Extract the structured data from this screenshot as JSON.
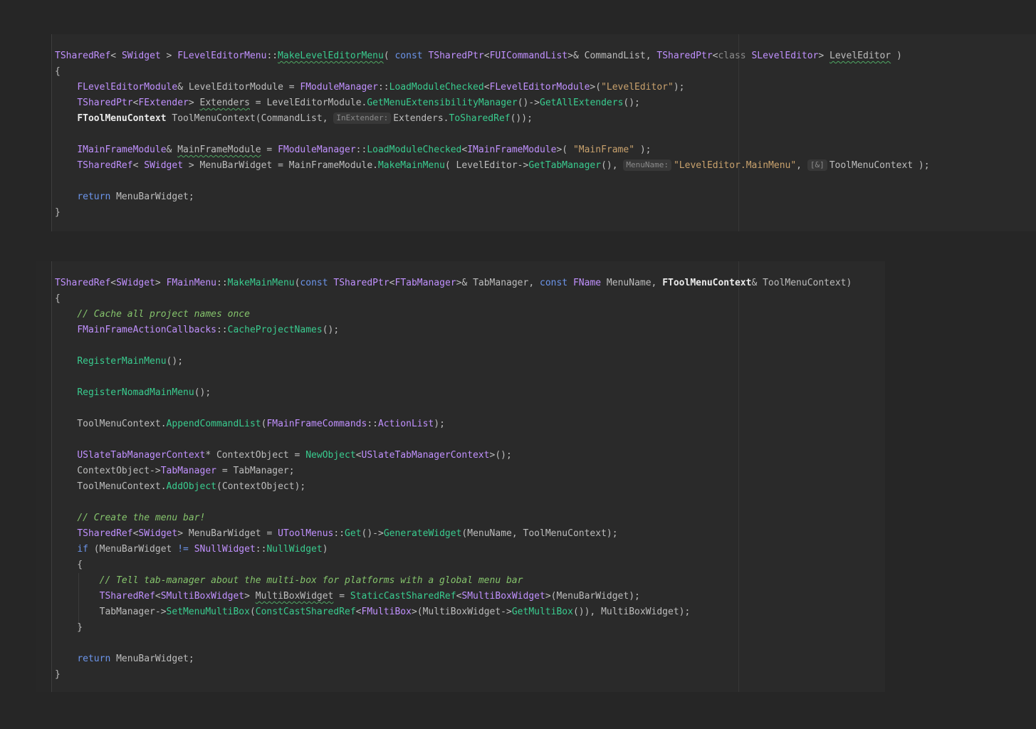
{
  "editor": {
    "description": "Dark IDE code viewer showing two C++ (Unreal Engine) function snippets",
    "colors": {
      "page_background": "#262626",
      "block_background": "#2a2a2a",
      "gutter_background": "#272727",
      "left_separator": "#3e3e3e",
      "right_margin_guide": "#363636",
      "indent_guide": "#3b3b3b",
      "text_default": "#bdbdbd",
      "text_type": "#c191ff",
      "text_method": "#39cc8f",
      "text_keyword": "#6c95eb",
      "text_string": "#c9a26d",
      "text_comment": "#85c46c",
      "text_dim_keyword": "#8c8c8c",
      "text_highlighted_usage": "#ebebeb",
      "inlay_hint_text": "#8a8a8a",
      "inlay_hint_background": "#383838",
      "typo_squiggle": "#4fa863"
    },
    "blocks": [
      {
        "name": "FLevelEditorMenu::MakeLevelEditorMenu",
        "lines": [
          [
            [
              "type",
              "TSharedRef"
            ],
            [
              "plain",
              "< "
            ],
            [
              "type",
              "SWidget"
            ],
            [
              "plain",
              " > "
            ],
            [
              "type",
              "FLevelEditorMenu"
            ],
            [
              "plain",
              "::"
            ],
            [
              "method",
              "MakeLevelEditorMenu",
              "typo"
            ],
            [
              "plain",
              "( "
            ],
            [
              "keyword",
              "const"
            ],
            [
              "plain",
              " "
            ],
            [
              "type",
              "TSharedPtr"
            ],
            [
              "plain",
              "<"
            ],
            [
              "type",
              "FUICommandList"
            ],
            [
              "plain",
              ">& CommandList, "
            ],
            [
              "type",
              "TSharedPtr"
            ],
            [
              "plain",
              "<"
            ],
            [
              "dim",
              "class"
            ],
            [
              "plain",
              " "
            ],
            [
              "type",
              "SLevelEditor"
            ],
            [
              "plain",
              "> "
            ],
            [
              "plain",
              "LevelEditor",
              "typo"
            ],
            [
              "plain",
              " )"
            ]
          ],
          [
            [
              "plain",
              "{"
            ]
          ],
          [
            [
              "plain",
              "    "
            ],
            [
              "type",
              "FLevelEditorModule"
            ],
            [
              "plain",
              "& LevelEditorModule = "
            ],
            [
              "type",
              "FModuleManager"
            ],
            [
              "plain",
              "::"
            ],
            [
              "method",
              "LoadModuleChecked"
            ],
            [
              "plain",
              "<"
            ],
            [
              "type",
              "FLevelEditorModule"
            ],
            [
              "plain",
              ">("
            ],
            [
              "string",
              "\"LevelEditor\""
            ],
            [
              "plain",
              ");"
            ]
          ],
          [
            [
              "plain",
              "    "
            ],
            [
              "type",
              "TSharedPtr"
            ],
            [
              "plain",
              "<"
            ],
            [
              "type",
              "FExtender"
            ],
            [
              "plain",
              "> "
            ],
            [
              "plain",
              "Extenders",
              "typo"
            ],
            [
              "plain",
              " = LevelEditorModule."
            ],
            [
              "method",
              "GetMenuExtensibilityManager"
            ],
            [
              "plain",
              "()->"
            ],
            [
              "method",
              "GetAllExtenders"
            ],
            [
              "plain",
              "();"
            ]
          ],
          [
            [
              "plain",
              "    "
            ],
            [
              "hl",
              "FToolMenuContext"
            ],
            [
              "plain",
              " ToolMenuContext(CommandList, "
            ],
            [
              "inlay",
              "InExtender:"
            ],
            [
              "plain",
              "Extenders."
            ],
            [
              "method",
              "ToSharedRef"
            ],
            [
              "plain",
              "());"
            ]
          ],
          [],
          [
            [
              "plain",
              "    "
            ],
            [
              "type",
              "IMainFrameModule"
            ],
            [
              "plain",
              "& "
            ],
            [
              "plain",
              "MainFrameModule",
              "typo"
            ],
            [
              "plain",
              " = "
            ],
            [
              "type",
              "FModuleManager"
            ],
            [
              "plain",
              "::"
            ],
            [
              "method",
              "LoadModuleChecked"
            ],
            [
              "plain",
              "<"
            ],
            [
              "type",
              "IMainFrameModule"
            ],
            [
              "plain",
              ">( "
            ],
            [
              "string",
              "\"MainFrame\""
            ],
            [
              "plain",
              " );"
            ]
          ],
          [
            [
              "plain",
              "    "
            ],
            [
              "type",
              "TSharedRef"
            ],
            [
              "plain",
              "< "
            ],
            [
              "type",
              "SWidget"
            ],
            [
              "plain",
              " > MenuBarWidget = MainFrameModule."
            ],
            [
              "method",
              "MakeMainMenu"
            ],
            [
              "plain",
              "( LevelEditor->"
            ],
            [
              "method",
              "GetTabManager"
            ],
            [
              "plain",
              "(), "
            ],
            [
              "inlay",
              "MenuName:"
            ],
            [
              "string",
              "\"LevelEditor.MainMenu\""
            ],
            [
              "plain",
              ", "
            ],
            [
              "inlay",
              "[&]"
            ],
            [
              "plain",
              "ToolMenuContext );"
            ]
          ],
          [],
          [
            [
              "plain",
              "    "
            ],
            [
              "keyword",
              "return"
            ],
            [
              "plain",
              " MenuBarWidget;"
            ]
          ],
          [
            [
              "plain",
              "}"
            ]
          ]
        ]
      },
      {
        "name": "FMainMenu::MakeMainMenu",
        "lines": [
          [
            [
              "type",
              "TSharedRef"
            ],
            [
              "plain",
              "<"
            ],
            [
              "type",
              "SWidget"
            ],
            [
              "plain",
              "> "
            ],
            [
              "type",
              "FMainMenu"
            ],
            [
              "plain",
              "::"
            ],
            [
              "method",
              "MakeMainMenu"
            ],
            [
              "plain",
              "("
            ],
            [
              "keyword",
              "const"
            ],
            [
              "plain",
              " "
            ],
            [
              "type",
              "TSharedPtr"
            ],
            [
              "plain",
              "<"
            ],
            [
              "type",
              "FTabManager"
            ],
            [
              "plain",
              ">& TabManager, "
            ],
            [
              "keyword",
              "const"
            ],
            [
              "plain",
              " "
            ],
            [
              "type",
              "FName"
            ],
            [
              "plain",
              " MenuName, "
            ],
            [
              "hl",
              "FToolMenuContext"
            ],
            [
              "plain",
              "& ToolMenuContext)"
            ]
          ],
          [
            [
              "plain",
              "{"
            ]
          ],
          [
            [
              "plain",
              "    "
            ],
            [
              "comment",
              "// Cache all project names once"
            ]
          ],
          [
            [
              "plain",
              "    "
            ],
            [
              "type",
              "FMainFrameActionCallbacks"
            ],
            [
              "plain",
              "::"
            ],
            [
              "method",
              "CacheProjectNames"
            ],
            [
              "plain",
              "();"
            ]
          ],
          [],
          [
            [
              "plain",
              "    "
            ],
            [
              "method",
              "RegisterMainMenu"
            ],
            [
              "plain",
              "();"
            ]
          ],
          [],
          [
            [
              "plain",
              "    "
            ],
            [
              "method",
              "RegisterNomadMainMenu"
            ],
            [
              "plain",
              "();"
            ]
          ],
          [],
          [
            [
              "plain",
              "    ToolMenuContext."
            ],
            [
              "method",
              "AppendCommandList"
            ],
            [
              "plain",
              "("
            ],
            [
              "type",
              "FMainFrameCommands"
            ],
            [
              "plain",
              "::"
            ],
            [
              "type",
              "ActionList"
            ],
            [
              "plain",
              ");"
            ]
          ],
          [],
          [
            [
              "plain",
              "    "
            ],
            [
              "type",
              "USlateTabManagerContext"
            ],
            [
              "plain",
              "* ContextObject = "
            ],
            [
              "method",
              "NewObject"
            ],
            [
              "plain",
              "<"
            ],
            [
              "type",
              "USlateTabManagerContext"
            ],
            [
              "plain",
              ">();"
            ]
          ],
          [
            [
              "plain",
              "    ContextObject->"
            ],
            [
              "type",
              "TabManager"
            ],
            [
              "plain",
              " = TabManager;"
            ]
          ],
          [
            [
              "plain",
              "    ToolMenuContext."
            ],
            [
              "method",
              "AddObject"
            ],
            [
              "plain",
              "(ContextObject);"
            ]
          ],
          [],
          [
            [
              "plain",
              "    "
            ],
            [
              "comment",
              "// Create the menu bar!"
            ]
          ],
          [
            [
              "plain",
              "    "
            ],
            [
              "type",
              "TSharedRef"
            ],
            [
              "plain",
              "<"
            ],
            [
              "type",
              "SWidget"
            ],
            [
              "plain",
              "> MenuBarWidget = "
            ],
            [
              "type",
              "UToolMenus"
            ],
            [
              "plain",
              "::"
            ],
            [
              "method",
              "Get"
            ],
            [
              "plain",
              "()->"
            ],
            [
              "method",
              "GenerateWidget"
            ],
            [
              "plain",
              "(MenuName, ToolMenuContext);"
            ]
          ],
          [
            [
              "plain",
              "    "
            ],
            [
              "keyword",
              "if"
            ],
            [
              "plain",
              " (MenuBarWidget "
            ],
            [
              "keyword",
              "!="
            ],
            [
              "plain",
              " "
            ],
            [
              "type",
              "SNullWidget"
            ],
            [
              "plain",
              "::"
            ],
            [
              "method",
              "NullWidget"
            ],
            [
              "plain",
              ")"
            ]
          ],
          [
            [
              "plain",
              "    {"
            ]
          ],
          [
            [
              "plain",
              "        "
            ],
            [
              "comment",
              "// Tell tab-manager about the multi-box for platforms with a global menu bar"
            ]
          ],
          [
            [
              "plain",
              "        "
            ],
            [
              "type",
              "TSharedRef"
            ],
            [
              "plain",
              "<"
            ],
            [
              "type",
              "SMultiBoxWidget"
            ],
            [
              "plain",
              "> "
            ],
            [
              "plain",
              "MultiBoxWidget",
              "typo"
            ],
            [
              "plain",
              " = "
            ],
            [
              "method",
              "StaticCastSharedRef"
            ],
            [
              "plain",
              "<"
            ],
            [
              "type",
              "SMultiBoxWidget"
            ],
            [
              "plain",
              ">(MenuBarWidget);"
            ]
          ],
          [
            [
              "plain",
              "        TabManager->"
            ],
            [
              "method",
              "SetMenuMultiBox"
            ],
            [
              "plain",
              "("
            ],
            [
              "method",
              "ConstCastSharedRef"
            ],
            [
              "plain",
              "<"
            ],
            [
              "type",
              "FMultiBox"
            ],
            [
              "plain",
              ">(MultiBoxWidget->"
            ],
            [
              "method",
              "GetMultiBox"
            ],
            [
              "plain",
              "()), MultiBoxWidget);"
            ]
          ],
          [
            [
              "plain",
              "    }"
            ]
          ],
          [],
          [
            [
              "plain",
              "    "
            ],
            [
              "keyword",
              "return"
            ],
            [
              "plain",
              " MenuBarWidget;"
            ]
          ],
          [
            [
              "plain",
              "}"
            ]
          ]
        ]
      }
    ]
  }
}
